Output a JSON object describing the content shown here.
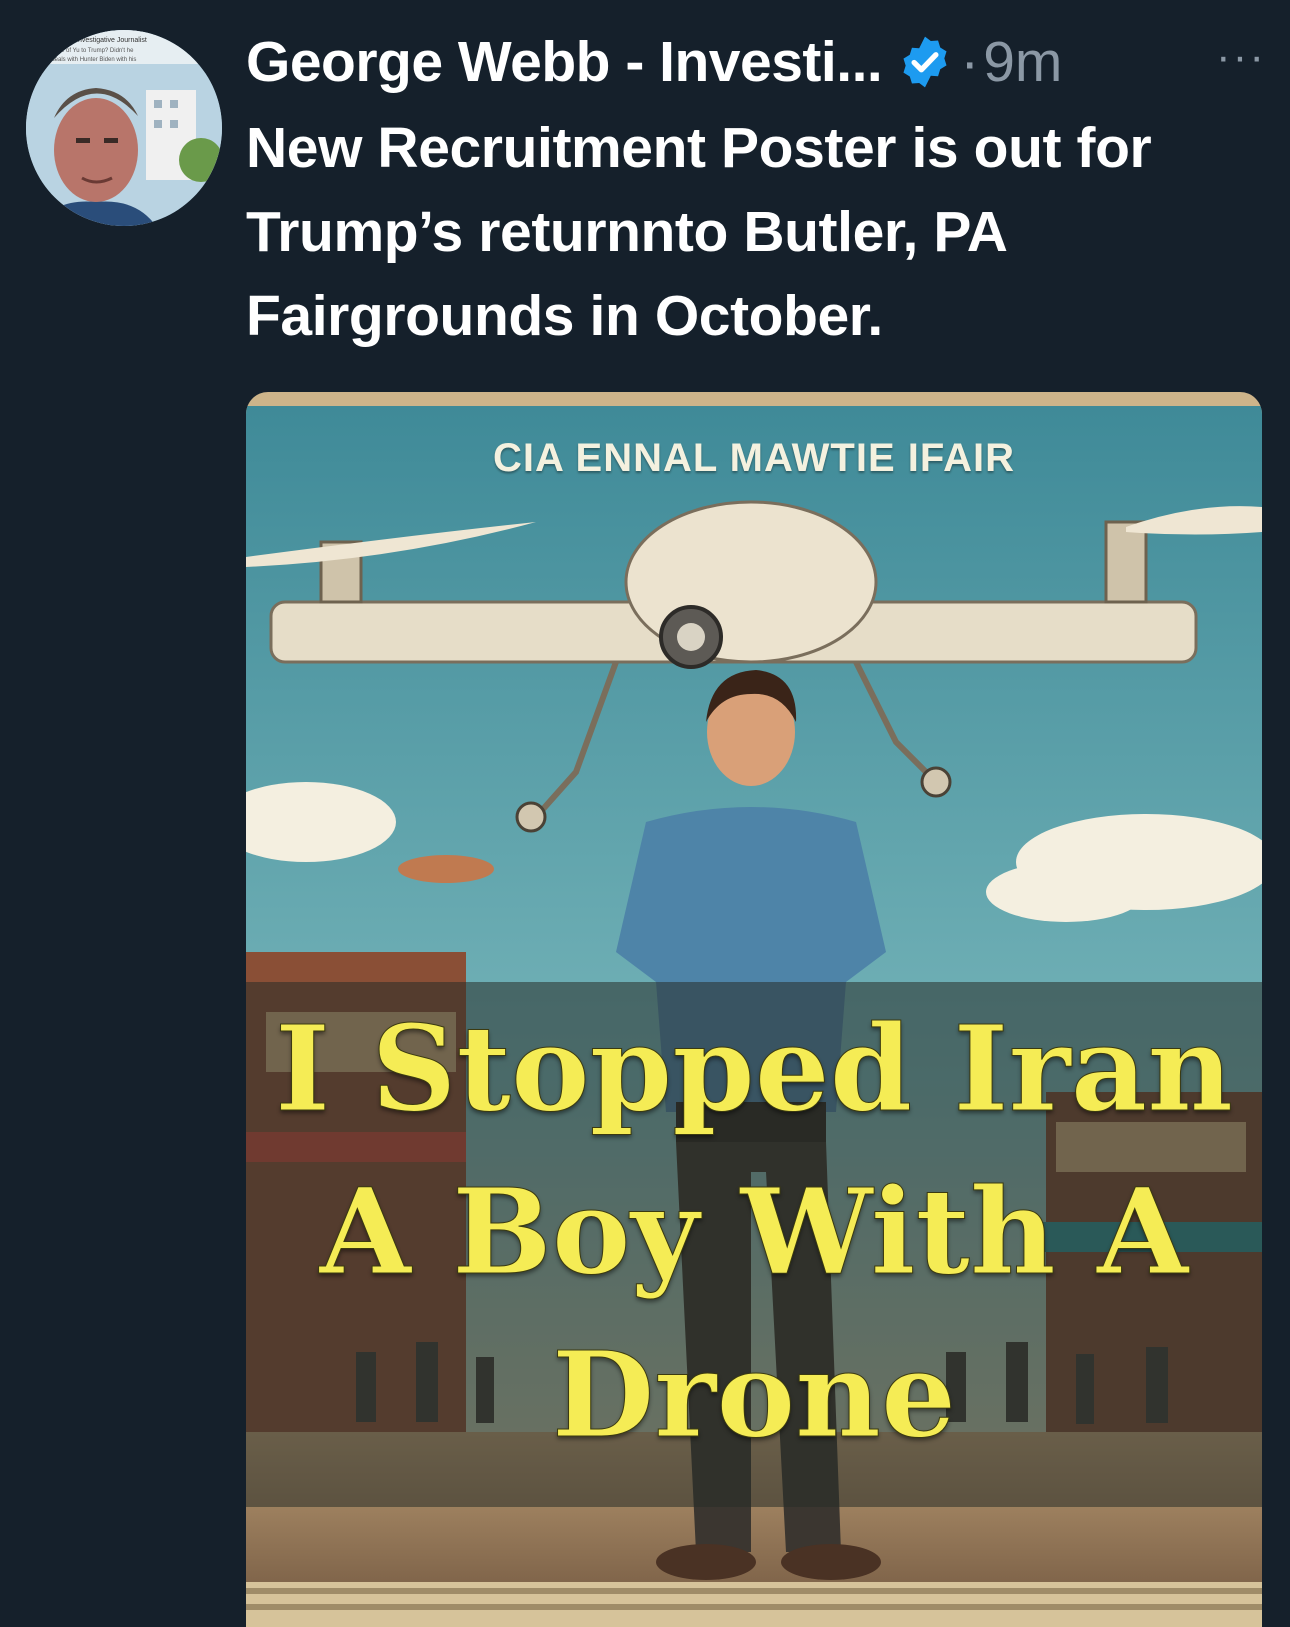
{
  "tweet": {
    "author_name": "George Webb - Investi...",
    "verified_icon": "verified-badge-icon",
    "separator": "·",
    "timestamp": "9m",
    "more_label": "···",
    "text": "New Recruitment Poster is out for Trump’s returnnto Butler, PA Fairgrounds in October."
  },
  "avatar": {
    "caption_lines": [
      "Investigative Journalist",
      "me of Yu to Trump? Didn't he",
      "ons deals with Hunter Biden with his"
    ]
  },
  "media": {
    "poster_title": "CIA ENNAL MAWTIE IFAIR",
    "caption_lines": [
      "I Stopped Iran",
      "A Boy With A",
      "Drone"
    ]
  },
  "colors": {
    "background": "#15202b",
    "text": "#ffffff",
    "muted": "#8b98a5",
    "verified": "#1d9bf0",
    "caption": "#f5ec55"
  }
}
